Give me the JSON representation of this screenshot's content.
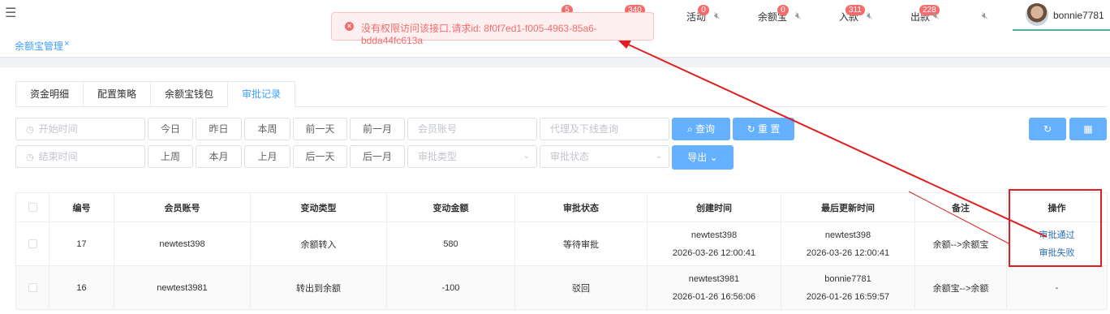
{
  "topbar": {
    "badges": [
      "5",
      "340",
      "0",
      "0",
      "311",
      "228"
    ],
    "nav": [
      "活动",
      "余额宝",
      "入款",
      "出款"
    ],
    "username": "bonnie7781"
  },
  "alert": {
    "message": "没有权限访问该接口,请求id: 8f0f7ed1-f005-4963-85a6-bdda44fc613a"
  },
  "page_tab": {
    "label": "余额宝管理",
    "close": "×"
  },
  "subtabs": [
    "资金明细",
    "配置策略",
    "余额宝钱包",
    "审批记录"
  ],
  "filters": {
    "start_placeholder": "开始时间",
    "end_placeholder": "结束时间",
    "row1_buttons": [
      "今日",
      "昨日",
      "本周",
      "前一天",
      "前一月"
    ],
    "row2_buttons": [
      "上周",
      "本月",
      "上月",
      "后一天",
      "后一月"
    ],
    "member_placeholder": "会员账号",
    "agent_placeholder": "代理及下线查询",
    "approve_type_placeholder": "审批类型",
    "approve_status_placeholder": "审批状态",
    "query": "查询",
    "reset": "重 置",
    "export": "导出"
  },
  "table": {
    "headers": [
      "编号",
      "会员账号",
      "变动类型",
      "变动金额",
      "审批状态",
      "创建时间",
      "最后更新时间",
      "备注",
      "操作"
    ],
    "rows": [
      {
        "id": "17",
        "account": "newtest398",
        "type": "余额转入",
        "amount": "580",
        "status": "等待审批",
        "created_by": "newtest398",
        "created_at": "2026-03-26 12:00:41",
        "updated_by": "newtest398",
        "updated_at": "2026-03-26 12:00:41",
        "remark": "余额-->余额宝",
        "action1": "审批通过",
        "action2": "审批失败"
      },
      {
        "id": "16",
        "account": "newtest3981",
        "type": "转出到余额",
        "amount": "-100",
        "status": "驳回",
        "created_by": "newtest3981",
        "created_at": "2026-01-26 16:56:06",
        "updated_by": "bonnie7781",
        "updated_at": "2026-01-26 16:59:57",
        "remark": "余额宝-->余额",
        "action": "-"
      }
    ]
  }
}
